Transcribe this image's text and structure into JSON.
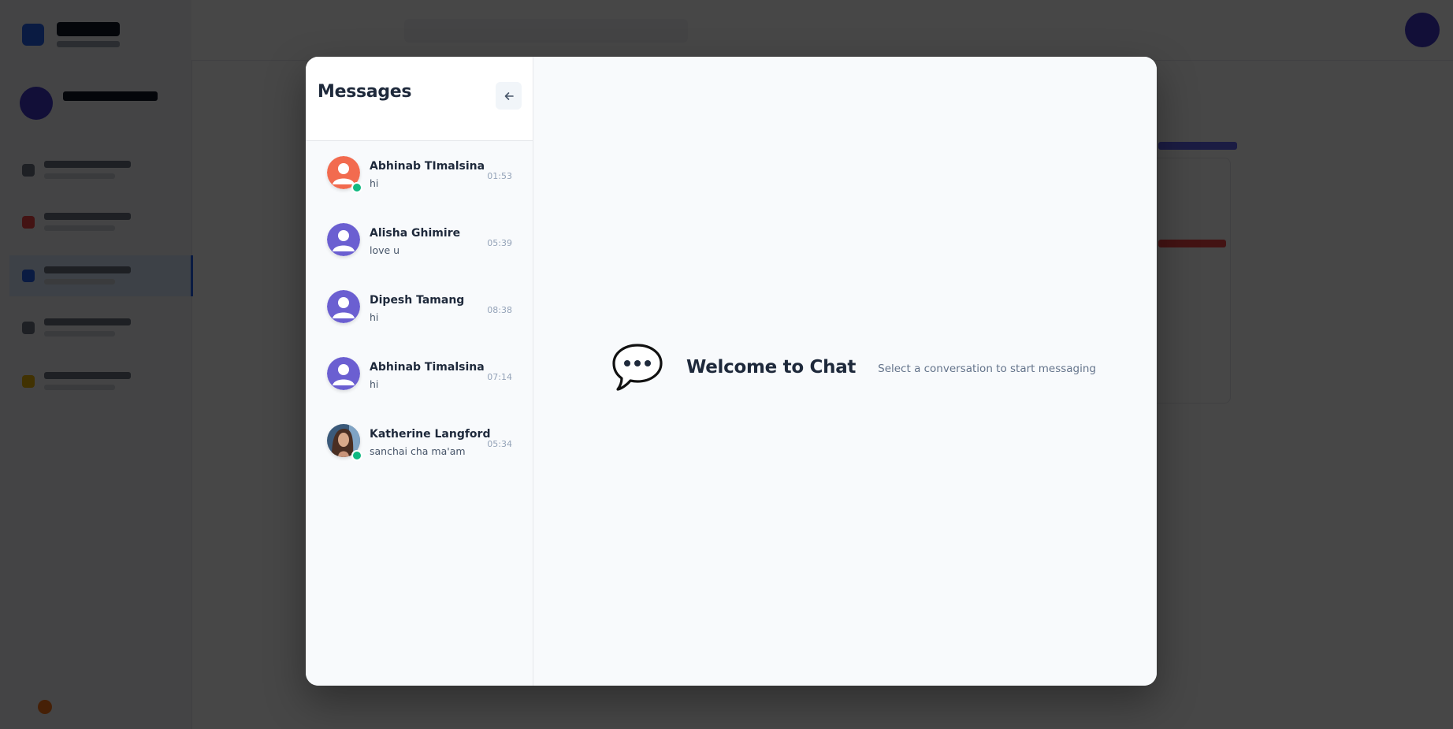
{
  "messages_panel": {
    "title": "Messages",
    "back_icon": "arrow-left-icon"
  },
  "conversations": [
    {
      "name": "Abhinab TImalsina",
      "preview": "hi",
      "time": "01:53",
      "avatar": "default-user-avatar",
      "avatar_color": "#f26b4f",
      "online": true
    },
    {
      "name": "Alisha Ghimire",
      "preview": "love u",
      "time": "05:39",
      "avatar": "default-user-avatar",
      "avatar_color": "#6b5fd1",
      "online": false
    },
    {
      "name": "Dipesh Tamang",
      "preview": "hi",
      "time": "08:38",
      "avatar": "default-user-avatar",
      "avatar_color": "#6b5fd1",
      "online": false
    },
    {
      "name": "Abhinab Timalsina",
      "preview": "hi",
      "time": "07:14",
      "avatar": "default-user-avatar",
      "avatar_color": "#6b5fd1",
      "online": false
    },
    {
      "name": "Katherine Langford",
      "preview": "sanchai cha ma'am",
      "time": "05:34",
      "avatar": "photo-avatar",
      "online": true
    }
  ],
  "welcome": {
    "icon": "chat-bubble-icon",
    "title": "Welcome to Chat",
    "subtitle": "Select a conversation to start messaging"
  },
  "colors": {
    "online": "#10b981",
    "heading": "#1e293b",
    "muted": "#94a3b8"
  }
}
